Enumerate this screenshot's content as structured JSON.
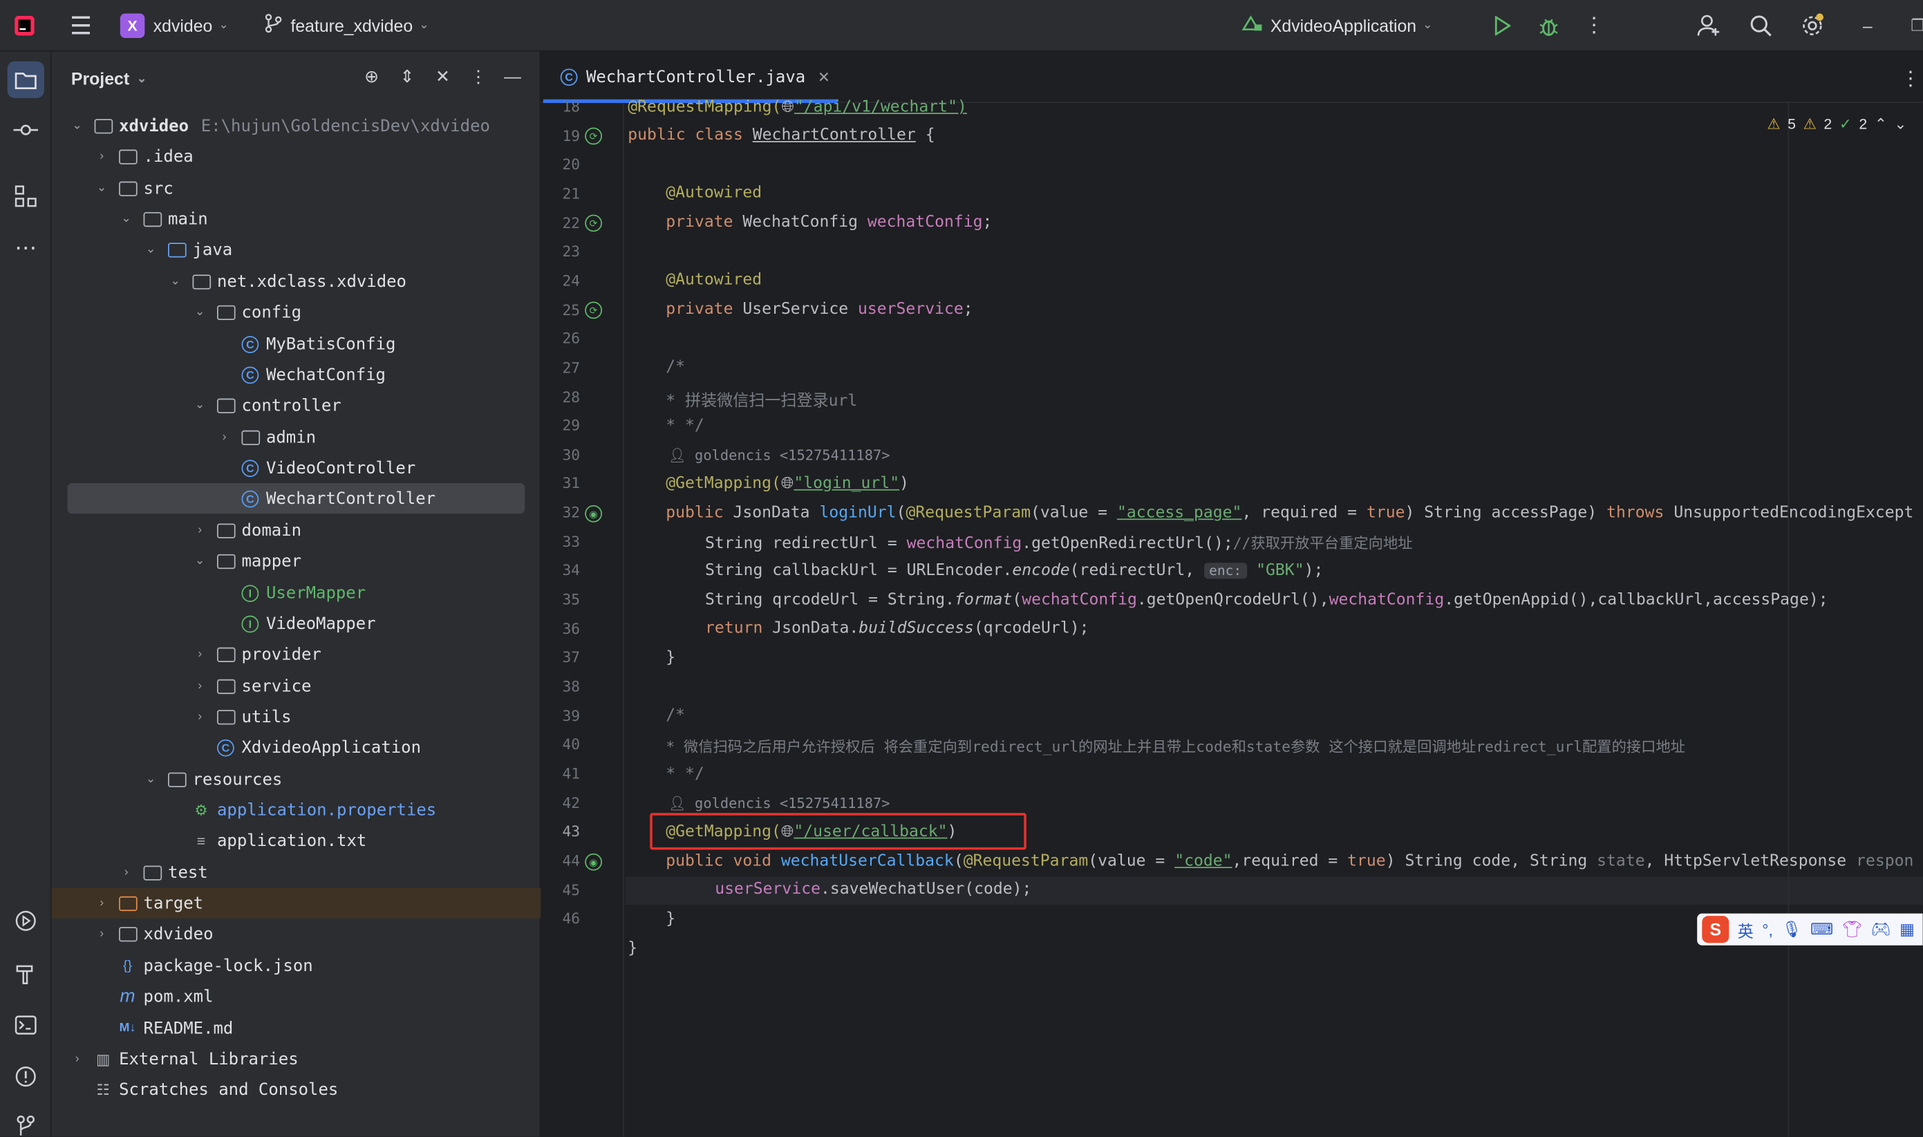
{
  "titlebar": {
    "project_badge": "X",
    "project_name": "xdvideo",
    "branch": "feature_xdvideo",
    "run_config": "XdvideoApplication"
  },
  "project_panel": {
    "title": "Project",
    "tree": [
      {
        "label": "xdvideo",
        "path": "E:\\hujun\\GoldencisDev\\xdvideo"
      },
      {
        "label": ".idea"
      },
      {
        "label": "src"
      },
      {
        "label": "main"
      },
      {
        "label": "java"
      },
      {
        "label": "net.xdclass.xdvideo"
      },
      {
        "label": "config"
      },
      {
        "label": "MyBatisConfig"
      },
      {
        "label": "WechatConfig"
      },
      {
        "label": "controller"
      },
      {
        "label": "admin"
      },
      {
        "label": "VideoController"
      },
      {
        "label": "WechartController"
      },
      {
        "label": "domain"
      },
      {
        "label": "mapper"
      },
      {
        "label": "UserMapper"
      },
      {
        "label": "VideoMapper"
      },
      {
        "label": "provider"
      },
      {
        "label": "service"
      },
      {
        "label": "utils"
      },
      {
        "label": "XdvideoApplication"
      },
      {
        "label": "resources"
      },
      {
        "label": "application.properties"
      },
      {
        "label": "application.txt"
      },
      {
        "label": "test"
      },
      {
        "label": "target"
      },
      {
        "label": "xdvideo"
      },
      {
        "label": "package-lock.json"
      },
      {
        "label": "pom.xml"
      },
      {
        "label": "README.md"
      },
      {
        "label": "External Libraries"
      },
      {
        "label": "Scratches and Consoles"
      }
    ]
  },
  "editor": {
    "tab_label": "WechartController.java",
    "inspections": {
      "warnings": "5",
      "weak_warnings": "2",
      "ok": "2"
    },
    "line_numbers": [
      "18",
      "19",
      "20",
      "21",
      "22",
      "23",
      "24",
      "25",
      "26",
      "27",
      "28",
      "29",
      "30",
      "31",
      "32",
      "33",
      "34",
      "35",
      "36",
      "37",
      "38",
      "39",
      "40",
      "41",
      "42",
      "43",
      "44",
      "45",
      "46"
    ],
    "author_hint": "goldencis <15275411187>",
    "code": {
      "l18a": "@RequestMapping(",
      "l18b": "\"/api/v1/wechart\")",
      "l19_kw": "public class ",
      "l19_name": "WechartController",
      "l19_rest": " {",
      "autowired": "@Autowired",
      "l22_kw": "private ",
      "l22_type": "WechatConfig ",
      "l22_field": "wechatConfig",
      "semi": ";",
      "l25_type": "UserService ",
      "l25_field": "userService",
      "c_open": "/*",
      "c28": "* 拼装微信扫一扫登录url",
      "c_close": "* */",
      "getmapping": "@GetMapping(",
      "l30_str": "\"login_url\"",
      "close_paren": ")",
      "l31_kw": "public ",
      "l31_type": "JsonData ",
      "l31_fn": "loginUrl",
      "l31_a": "(",
      "reqparam": "@RequestParam",
      "l31_b": "(value = ",
      "l31_str": "\"access_page\"",
      "l31_c": ", required = ",
      "true_kw": "true",
      "l31_d": ") String accessPage) ",
      "throws_kw": "throws",
      "l31_e": " UnsupportedEncodingExcept",
      "l32_a": "String redirectUrl = ",
      "l32_f": "wechatConfig",
      "l32_b": ".getOpenRedirectUrl();",
      "l32_c": "//获取开放平台重定向地址",
      "l33_a": "String callbackUrl = URLEncoder.",
      "l33_i": "encode",
      "l33_b": "(redirectUrl,",
      "l33_hint": "enc:",
      "l33_str": "\"GBK\"",
      "l33_c": ");",
      "l34_a": "String qrcodeUrl = String.",
      "l34_i": "format",
      "l34_b": "(",
      "l34_f1": "wechatConfig",
      "l34_c": ".getOpenQrcodeUrl(),",
      "l34_f2": "wechatConfig",
      "l34_d": ".getOpenAppid(),callbackUrl,accessPage);",
      "return_kw": "return ",
      "l35_a": "JsonData.",
      "l35_i": "buildSuccess",
      "l35_b": "(qrcodeUrl);",
      "brace_close": "}",
      "c39": "* 微信扫码之后用户允许授权后 将会重定向到redirect_url的网址上并且带上code和state参数 这个接口就是回调地址redirect_url配置的接口地址",
      "l41_str": "\"/user/callback\"",
      "l42_kw": "public void ",
      "l42_fn": "wechatUserCallback",
      "l42_a": "(",
      "l42_b": "(value = ",
      "l42_str": "\"code\"",
      "l42_c": ",required = ",
      "l42_d": ") String code, String ",
      "l42_state": "state",
      "l42_e": ", HttpServletResponse ",
      "l42_resp": "respon",
      "l43_f": "userService",
      "l43_a": ".saveWechatUser",
      "l43_b": "(code);"
    }
  },
  "ime": {
    "logo": "S",
    "mode": "英",
    "punct": "°,"
  }
}
